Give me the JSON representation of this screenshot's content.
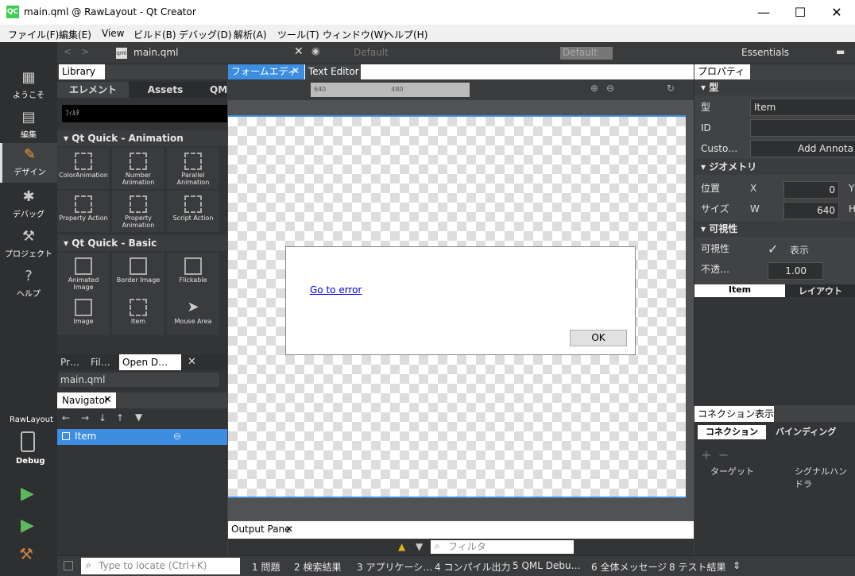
{
  "window": {
    "title": "main.qml @ RawLayout - Qt Creator",
    "logo": "QC",
    "minimize": "—",
    "maximize": "☐",
    "close": "✕"
  },
  "menu": [
    "ファイル(F)",
    "編集(E)",
    "View",
    "ビルド(B)",
    "デバッグ(D)",
    "解析(A)",
    "ツール(T)",
    "ウィンドウ(W)",
    "ヘルプ(H)"
  ],
  "modes": [
    {
      "label": "ようこそ",
      "icon": "grid-icon"
    },
    {
      "label": "編集",
      "icon": "document-icon"
    },
    {
      "label": "デザイン",
      "icon": "pencil-icon"
    },
    {
      "label": "デバッグ",
      "icon": "bug-icon"
    },
    {
      "label": "プロジェクト",
      "icon": "wrench-icon"
    },
    {
      "label": "ヘルプ",
      "icon": "help-icon"
    }
  ],
  "kit": {
    "project": "RawLayout",
    "config": "Debug"
  },
  "toolbar": {
    "file": "main.qml",
    "style": "Default",
    "state": "Default",
    "workspace": "Essentials"
  },
  "library": {
    "title": "Library",
    "tabs": [
      "エレメント",
      "Assets",
      "QML"
    ],
    "filter": "ﾌｨﾙﾀ",
    "sections": [
      {
        "title": "Qt Quick - Animation",
        "items": [
          "ColorAnimation",
          "Number Animation",
          "Parallel Animation",
          "Property Action",
          "Property Animation",
          "Script Action"
        ]
      },
      {
        "title": "Qt Quick - Basic",
        "items": [
          "Animated Image",
          "Border Image",
          "Flickable",
          "Image",
          "Item",
          "Mouse Area"
        ]
      }
    ]
  },
  "bottom_tabs": [
    "Pr…",
    "Fil…",
    "Open D…"
  ],
  "open_docs": [
    "main.qml"
  ],
  "navigator": {
    "title": "Navigator",
    "item": "Item"
  },
  "editor": {
    "tabs": [
      "フォームエディタ",
      "Text Editor"
    ],
    "ruler": [
      "640",
      "480"
    ]
  },
  "dialog": {
    "link": "Go to error",
    "ok": "OK"
  },
  "output": {
    "title": "Output Pane",
    "filter": "フィルタ"
  },
  "properties": {
    "title": "プロパティ",
    "section_type": "型",
    "type_label": "型",
    "type_value": "Item",
    "id_label": "ID",
    "custom_label": "Custo…",
    "add_annotation": "Add Annota",
    "section_geometry": "ジオメトリ",
    "pos_label": "位置",
    "x_label": "X",
    "x_value": "0",
    "y_label": "Y",
    "size_label": "サイズ",
    "w_label": "W",
    "w_value": "640",
    "h_label": "H",
    "section_visibility": "可視性",
    "visibility_label": "可視性",
    "visible_label": "表示",
    "opacity_label": "不透…",
    "opacity_value": "1.00",
    "tabs": [
      "Item",
      "レイアウト"
    ]
  },
  "connections": {
    "title": "コネクション表示",
    "tabs": [
      "コネクション",
      "バインディング"
    ],
    "cols": [
      "ターゲット",
      "シグナルハンドラ"
    ]
  },
  "statusbar": {
    "locate": "Type to locate (Ctrl+K)",
    "panes": [
      "1 問題",
      "2 検索結果",
      "3 アプリケーシ…",
      "4 コンパイル出力",
      "5 QML Debu…",
      "6 全体メッセージ",
      "8 テスト結果"
    ]
  }
}
